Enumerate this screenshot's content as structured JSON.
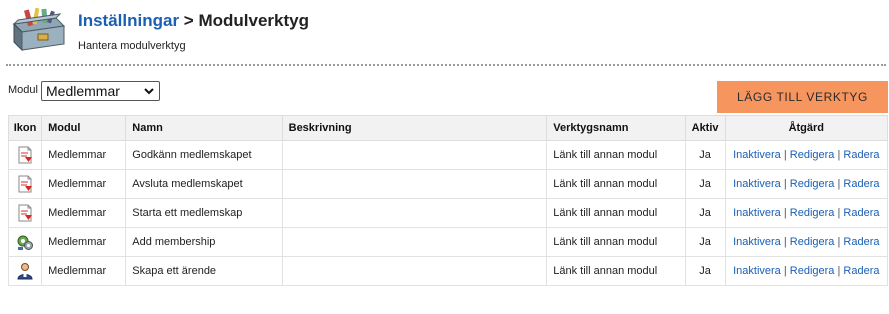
{
  "header": {
    "breadcrumb_parent": "Inställningar",
    "separator": " > ",
    "title": "Modulverktyg",
    "subtitle": "Hantera modulverktyg"
  },
  "filter": {
    "label": "Modul",
    "selected": "Medlemmar"
  },
  "add_button": "LÄGG TILL VERKTYG",
  "table": {
    "columns": [
      "Ikon",
      "Modul",
      "Namn",
      "Beskrivning",
      "Verktygsnamn",
      "Aktiv",
      "Åtgärd"
    ],
    "actions": {
      "deactivate": "Inaktivera",
      "edit": "Redigera",
      "delete": "Radera",
      "separator": "|"
    },
    "rows": [
      {
        "icon": "document-icon",
        "module": "Medlemmar",
        "name": "Godkänn medlemskapet",
        "description": "",
        "tool_name": "Länk till annan modul",
        "active": "Ja"
      },
      {
        "icon": "document-icon",
        "module": "Medlemmar",
        "name": "Avsluta medlemskapet",
        "description": "",
        "tool_name": "Länk till annan modul",
        "active": "Ja"
      },
      {
        "icon": "document-icon",
        "module": "Medlemmar",
        "name": "Starta ett medlemskap",
        "description": "",
        "tool_name": "Länk till annan modul",
        "active": "Ja"
      },
      {
        "icon": "gears-icon",
        "module": "Medlemmar",
        "name": "Add membership",
        "description": "",
        "tool_name": "Länk till annan modul",
        "active": "Ja"
      },
      {
        "icon": "user-icon",
        "module": "Medlemmar",
        "name": "Skapa ett ärende",
        "description": "",
        "tool_name": "Länk till annan modul",
        "active": "Ja"
      }
    ]
  },
  "colors": {
    "link": "#1a5fb4",
    "button": "#f7955e",
    "active": "#2e7d32"
  }
}
